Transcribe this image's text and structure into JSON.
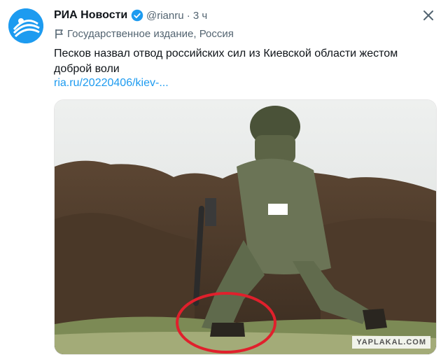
{
  "tweet": {
    "author_name": "РИА Новости",
    "handle_time": "@rianru · 3 ч",
    "label": "Государственное издание, Россия",
    "text": "Песков назвал отвод российских сил из Киевской области жестом доброй воли",
    "link": "ria.ru/20220406/kiev-..."
  },
  "media": {
    "watermark": "YAPLAKAL.COM",
    "highlight_color": "#e0202c"
  },
  "colors": {
    "accent": "#1d9bf0",
    "secondary_text": "#536471"
  },
  "icons": {
    "verified": "verified-badge-icon",
    "label": "flag-icon",
    "close": "close-icon"
  }
}
